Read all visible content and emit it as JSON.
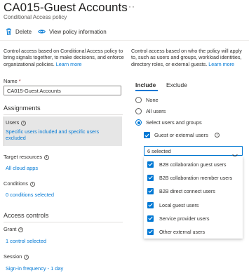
{
  "header": {
    "title": "CA015-Guest Accounts",
    "more": "···",
    "subtitle": "Conditional Access policy"
  },
  "toolbar": {
    "delete_label": "Delete",
    "view_info_label": "View policy information"
  },
  "left": {
    "desc_text": "Control access based on Conditional Access policy to bring signals together, to make decisions, and enforce organizational policies.",
    "desc_link": "Learn more",
    "name_label": "Name",
    "name_required": "*",
    "name_value": "CA015-Guest Accounts",
    "assignments": {
      "heading": "Assignments",
      "users_label": "Users",
      "users_value": "Specific users included and specific users excluded",
      "target_label": "Target resources",
      "target_value": "All cloud apps",
      "conditions_label": "Conditions",
      "conditions_value": "0 conditions selected"
    },
    "access_controls": {
      "heading": "Access controls",
      "grant_label": "Grant",
      "grant_value": "1 control selected",
      "session_label": "Session",
      "session_value": "Sign-in frequency - 1 day"
    }
  },
  "right": {
    "desc_text": "Control access based on who the policy will apply to, such as users and groups, workload identities, directory roles, or external guests.",
    "desc_link": "Learn more",
    "tabs": [
      {
        "label": "Include",
        "active": true
      },
      {
        "label": "Exclude",
        "active": false
      }
    ],
    "options": [
      {
        "label": "None",
        "selected": false
      },
      {
        "label": "All users",
        "selected": false
      },
      {
        "label": "Select users and groups",
        "selected": true
      }
    ],
    "guest_label": "Guest or external users",
    "dropdown_value": "6 selected",
    "dropdown_items": [
      {
        "label": "B2B collaboration guest users",
        "checked": true
      },
      {
        "label": "B2B collaboration member users",
        "checked": true
      },
      {
        "label": "B2B direct connect users",
        "checked": true
      },
      {
        "label": "Local guest users",
        "checked": true
      },
      {
        "label": "Service provider users",
        "checked": true
      },
      {
        "label": "Other external users",
        "checked": true
      }
    ]
  },
  "colors": {
    "accent": "#0078d4",
    "required": "#a4262c",
    "selected_bg": "#e6e6e6"
  }
}
